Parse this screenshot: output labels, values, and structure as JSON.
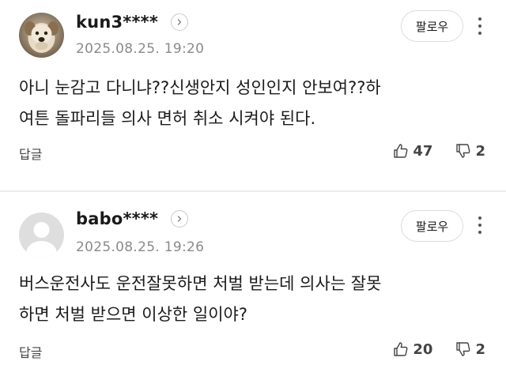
{
  "comments": [
    {
      "username": "kun3****",
      "timestamp": "2025.08.25. 19:20",
      "follow_label": "팔로우",
      "body_line1": "아니 눈감고 다니냐??신생안지 성인인지 안보여??하",
      "body_line2": "여튼 돌파리들 의사 면허 취소 시켜야 된다.",
      "reply_label": "답글",
      "likes": "47",
      "dislikes": "2",
      "avatar": "dog-photo"
    },
    {
      "username": "babo****",
      "timestamp": "2025.08.25. 19:26",
      "follow_label": "팔로우",
      "body_line1": "버스운전사도 운전잘못하면 처벌 받는데 의사는 잘못",
      "body_line2": "하면 처벌 받으면 이상한 일이야?",
      "reply_label": "답글",
      "likes": "20",
      "dislikes": "2",
      "avatar": "default-user-icon"
    }
  ],
  "colors": {
    "text": "#1a1a1a",
    "muted": "#8a8a8a",
    "border": "#dcdcdc",
    "divider": "#ececec"
  }
}
